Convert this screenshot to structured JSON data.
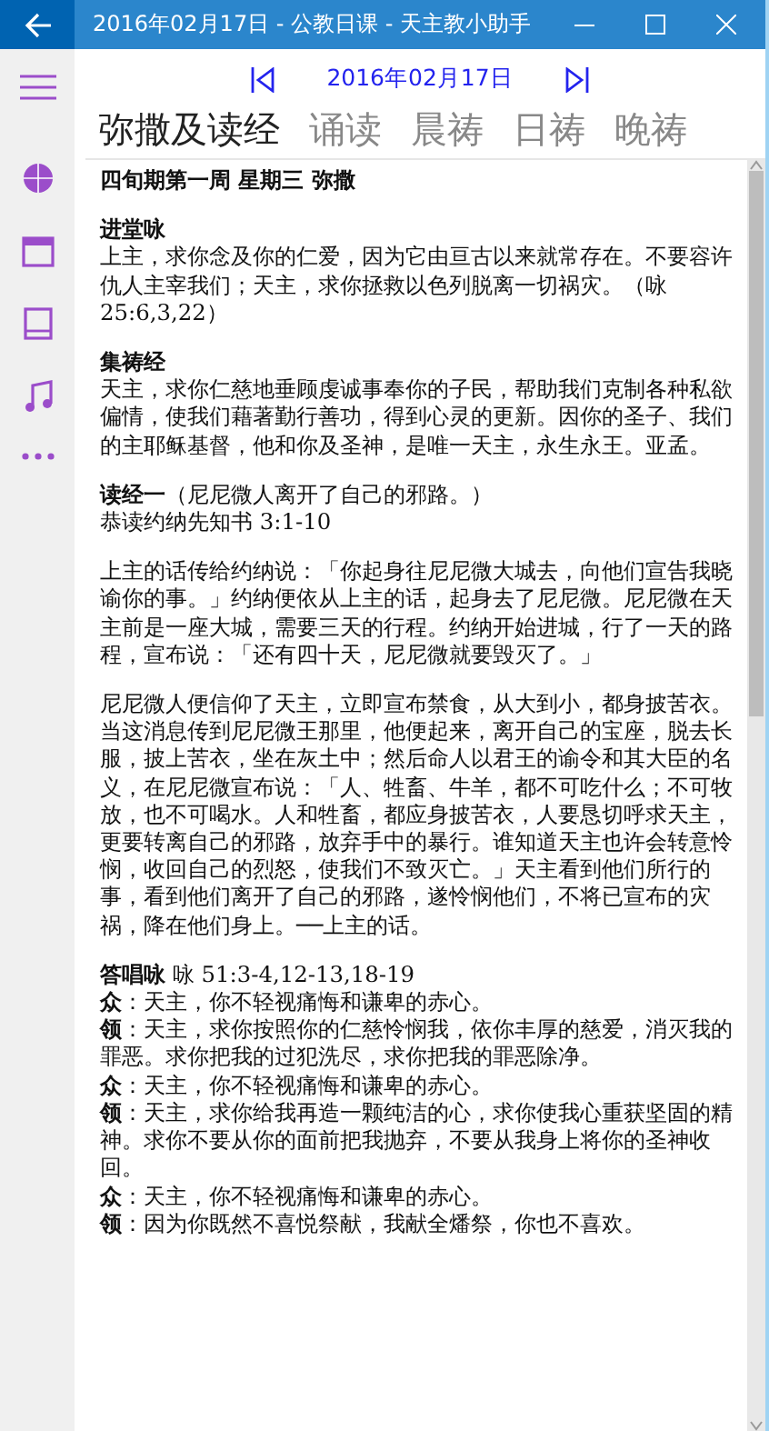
{
  "window": {
    "title": "2016年02月17日 - 公教日课 - 天主教小助手"
  },
  "sidebar": {
    "items": [
      {
        "kind": "menu"
      },
      {
        "kind": "news"
      },
      {
        "kind": "calendar"
      },
      {
        "kind": "book"
      },
      {
        "kind": "music"
      },
      {
        "kind": "more"
      }
    ]
  },
  "date_nav": {
    "date": "2016年02月17日"
  },
  "tabs": [
    {
      "label": "弥撒及读经",
      "selected": true
    },
    {
      "label": "诵读",
      "selected": false
    },
    {
      "label": "晨祷",
      "selected": false
    },
    {
      "label": "日祷",
      "selected": false
    },
    {
      "label": "晚祷",
      "selected": false
    }
  ],
  "document": {
    "title": "四旬期第一周 星期三 弥撒",
    "sections": [
      {
        "heading": "进堂咏",
        "lines": [
          "上主，求你念及你的仁爱，因为它由亘古以来就常存在。不要容许仇人主宰我们；天主，求你拯救以色列脱离一切祸灾。（咏 25:6,3,22）"
        ]
      },
      {
        "heading": "集祷经",
        "lines": [
          "天主，求你仁慈地垂顾虔诚事奉你的子民，帮助我们克制各种私欲偏情，使我们藉著勤行善功，得到心灵的更新。因你的圣子、我们的主耶稣基督，他和你及圣神，是唯一天主，永生永王。亚孟。"
        ]
      },
      {
        "lines": [
          "**读经一**（尼尼微人离开了自己的邪路。）",
          "恭读约纳先知书 3:1-10"
        ]
      },
      {
        "lines": [
          "上主的话传给约纳说：「你起身往尼尼微大城去，向他们宣告我晓谕你的事。」约纳便依从上主的话，起身去了尼尼微。尼尼微在天主前是一座大城，需要三天的行程。约纳开始进城，行了一天的路程，宣布说：「还有四十天，尼尼微就要毁灭了。」"
        ]
      },
      {
        "lines": [
          "尼尼微人便信仰了天主，立即宣布禁食，从大到小，都身披苦衣。当这消息传到尼尼微王那里，他便起来，离开自己的宝座，脱去长服，披上苦衣，坐在灰土中；然后命人以君王的谕令和其大臣的名义，在尼尼微宣布说：「人、牲畜、牛羊，都不可吃什么；不可牧放，也不可喝水。人和牲畜，都应身披苦衣，人要恳切呼求天主，更要转离自己的邪路，放弃手中的暴行。谁知道天主也许会转意怜悯，收回自己的烈怒，使我们不致灭亡。」天主看到他们所行的事，看到他们离开了自己的邪路，遂怜悯他们，不将已宣布的灾祸，降在他们身上。──上主的话。"
        ]
      },
      {
        "lines": [
          "**答唱咏** 咏 51:3-4,12-13,18-19",
          "**众**：天主，你不轻视痛悔和谦卑的赤心。",
          "**领**：天主，求你按照你的仁慈怜悯我，依你丰厚的慈爱，消灭我的罪恶。求你把我的过犯洗尽，求你把我的罪恶除净。",
          "**众**：天主，你不轻视痛悔和谦卑的赤心。",
          "**领**：天主，求你给我再造一颗纯洁的心，求你使我心重获坚固的精神。求你不要从你的面前把我抛弃，不要从我身上将你的圣神收回。",
          "**众**：天主，你不轻视痛悔和谦卑的赤心。",
          "**领**：因为你既然不喜悦祭献，我献全燔祭，你也不喜欢。"
        ]
      }
    ]
  }
}
